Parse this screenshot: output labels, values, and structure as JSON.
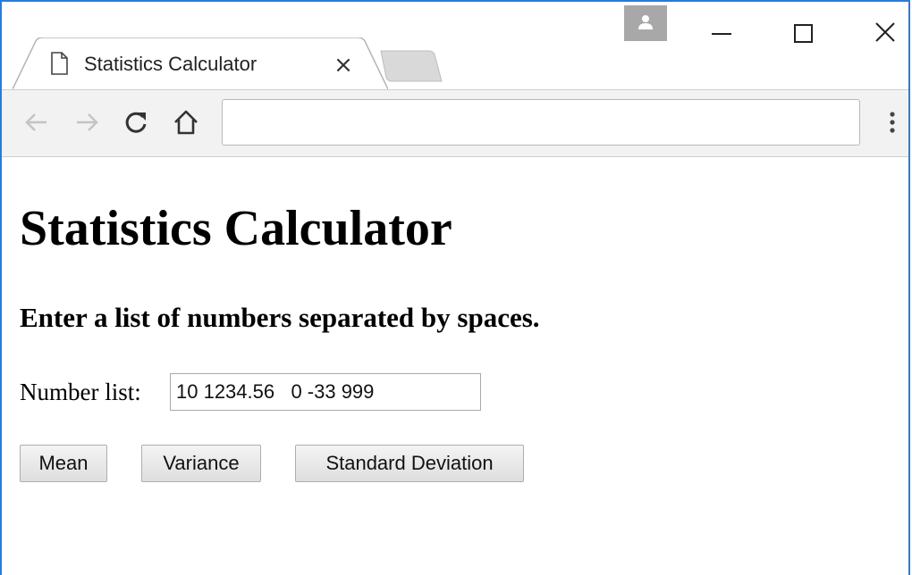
{
  "browser": {
    "tab_title": "Statistics Calculator",
    "tab_close_glyph": "×",
    "address_value": "",
    "icons": {
      "page": "page-icon",
      "profile": "person-icon",
      "minimize": "minimize-icon",
      "maximize": "maximize-icon",
      "close": "close-icon",
      "back": "back-arrow-icon",
      "forward": "forward-arrow-icon",
      "reload": "reload-icon",
      "home": "home-icon",
      "menu": "three-dots-menu-icon"
    },
    "colors": {
      "window_border": "#2b7bd6",
      "toolbar_bg": "#f2f2f2",
      "profile_bg": "#a8a8a8"
    }
  },
  "page": {
    "title": "Statistics Calculator",
    "instructions": "Enter a list of numbers separated by spaces.",
    "field_label": "Number list:",
    "number_list_value": "10 1234.56   0 -33 999",
    "buttons": {
      "mean": "Mean",
      "variance": "Variance",
      "stddev": "Standard Deviation"
    }
  }
}
